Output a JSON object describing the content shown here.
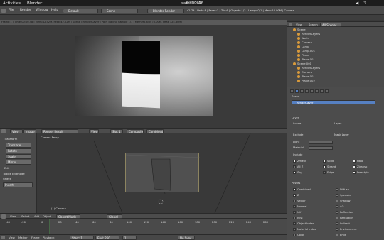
{
  "gnome": {
    "activities": "Activities",
    "app": "Blender",
    "clock": "sam. 11:46",
    "window_title": "Blender"
  },
  "info_header": {
    "menus": [
      "File",
      "Render",
      "Window",
      "Help"
    ],
    "layout": "Default",
    "scene": "Scene",
    "engine": "Blender Render",
    "stats": "v2.79 | Verts:8 | Faces:3 | Tris:6 | Objects:1/3 | Lamps:0/1 | Mem:16.90M | Camera"
  },
  "render_info": "Frame:1 | Time:00:00.48 | Mem:42.52M, Peak:42.52M | Scene | RenderLayer | Path Tracing Sample 1/1 | Mem:92.85M (0.00M, Peak 124.30M)",
  "image_header": {
    "menus": [
      "View",
      "Image"
    ],
    "image_name": "Render Result",
    "slot": "Slot 1",
    "layer": "Composite",
    "pass": "Combined"
  },
  "tool_shelf": {
    "title": "Transform",
    "tools": [
      "Translate",
      "Rotate",
      "Scale",
      "Mirror"
    ],
    "edit_title": "Edit",
    "redo": "Toggle Editmode",
    "panel_label": "Select",
    "panel_value": "Invert"
  },
  "viewport": {
    "overlay_top": "Camera Persp",
    "overlay_bottom": "(1) Camera",
    "menus": [
      "View",
      "Select",
      "Add",
      "Object"
    ],
    "mode": "Object Mode",
    "shading": "Global"
  },
  "timeline": {
    "menus": [
      "View",
      "Marker",
      "Frame",
      "Playback"
    ],
    "start": "Start: 1",
    "end": "End: 250",
    "current": "1",
    "ticks": [
      "-40",
      "-20",
      "0",
      "20",
      "40",
      "60",
      "80",
      "100",
      "120",
      "140",
      "160",
      "180",
      "200",
      "220",
      "240",
      "260"
    ],
    "sync": "No Sync"
  },
  "outliner": {
    "menus": [
      "View",
      "Search"
    ],
    "filter": "All Scenes",
    "items": [
      {
        "label": "Scene",
        "level": 0
      },
      {
        "label": "RenderLayers",
        "level": 1
      },
      {
        "label": "World",
        "level": 1
      },
      {
        "label": "Camera",
        "level": 1
      },
      {
        "label": "Lamp",
        "level": 1
      },
      {
        "label": "Lamp.001",
        "level": 1
      },
      {
        "label": "Plane",
        "level": 1
      },
      {
        "label": "Plane.001",
        "level": 1
      },
      {
        "label": "Scene.001",
        "level": 0
      },
      {
        "label": "RenderLayers",
        "level": 1
      },
      {
        "label": "Camera",
        "level": 1
      },
      {
        "label": "Plane.001",
        "level": 1
      },
      {
        "label": "Plane.002",
        "level": 1
      }
    ]
  },
  "properties": {
    "breadcrumb": "Scene",
    "layer_name": "RenderLayer",
    "sections": {
      "layer": "Layer",
      "scene": "Scene",
      "layer2": "Layer",
      "exclude": "Exclude",
      "mask_layer": "Mask Layer",
      "light": "Light",
      "material": "Material",
      "include": "Include",
      "passes": "Passes",
      "views": "Views"
    },
    "include_items": [
      "Zmask",
      "Solid",
      "Halo",
      "All Z",
      "Strand",
      "Ztransp",
      "Sky",
      "Edge",
      "Freestyle"
    ],
    "passes_left": [
      "Combined",
      "Z",
      "Vector",
      "Normal",
      "UV",
      "Mist",
      "Object Index",
      "Material Index",
      "Color"
    ],
    "passes_right": [
      "Diffuse",
      "Specular",
      "Shadow",
      "AO",
      "Reflection",
      "Refraction",
      "Indirect",
      "Environment",
      "Emit"
    ]
  },
  "colors": {
    "accent": "#5680c2",
    "orange": "#d89a3b",
    "bg": "#3a3a3a"
  }
}
